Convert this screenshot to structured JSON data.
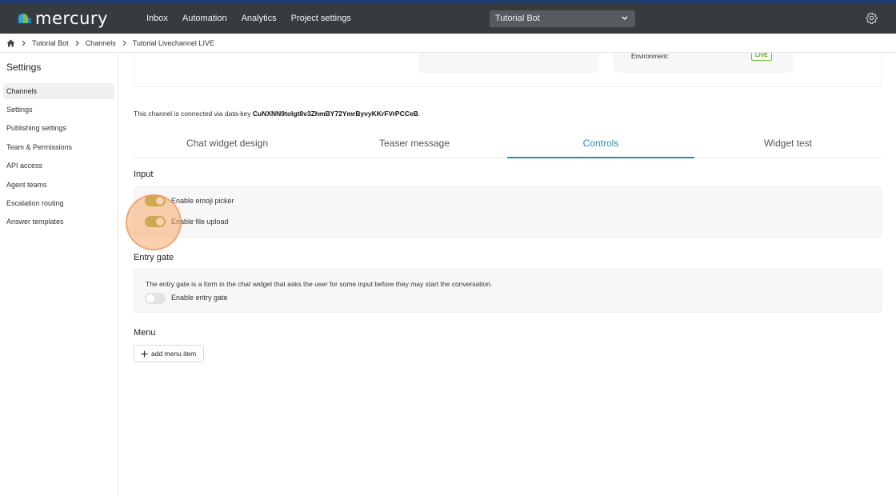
{
  "app": {
    "brand": "mercury"
  },
  "nav": {
    "items": [
      "Inbox",
      "Automation",
      "Analytics",
      "Project settings"
    ]
  },
  "bot_select": {
    "value": "Tutorial Bot"
  },
  "breadcrumb": {
    "items": [
      "Tutorial Bot",
      "Channels",
      "Tutorial Livechannel LIVE"
    ]
  },
  "sidebar": {
    "title": "Settings",
    "items": [
      "Channels",
      "Settings",
      "Publishing settings",
      "Team & Permissions",
      "API access",
      "Agent teams",
      "Escalation routing",
      "Answer templates"
    ],
    "active": "Channels"
  },
  "channel": {
    "environment_label": "Environment:",
    "environment_value": "LIVE",
    "datakey_prefix": "This channel is connected via data-key ",
    "datakey": "CuNXNN9tolgt8v3ZhmBY72YmrByvyKKrFVrPCCeB",
    "datakey_suffix": "."
  },
  "tabs": {
    "items": [
      "Chat widget design",
      "Teaser message",
      "Controls",
      "Widget test"
    ],
    "active": "Controls"
  },
  "input_section": {
    "title": "Input",
    "emoji_label": "Enable emoji picker",
    "emoji_enabled": true,
    "upload_label": "Enable file upload",
    "upload_enabled": true
  },
  "entry_gate": {
    "title": "Entry gate",
    "description": "The entry gate is a form in the chat widget that asks the user for some input before they may start the conversation.",
    "toggle_label": "Enable entry gate",
    "enabled": false
  },
  "menu": {
    "title": "Menu",
    "add_label": "add menu item"
  },
  "colors": {
    "topbar": "#383b3e",
    "accent": "#2b8ea8",
    "toggle_on": "#a2a62c",
    "live": "#6aa93a"
  }
}
